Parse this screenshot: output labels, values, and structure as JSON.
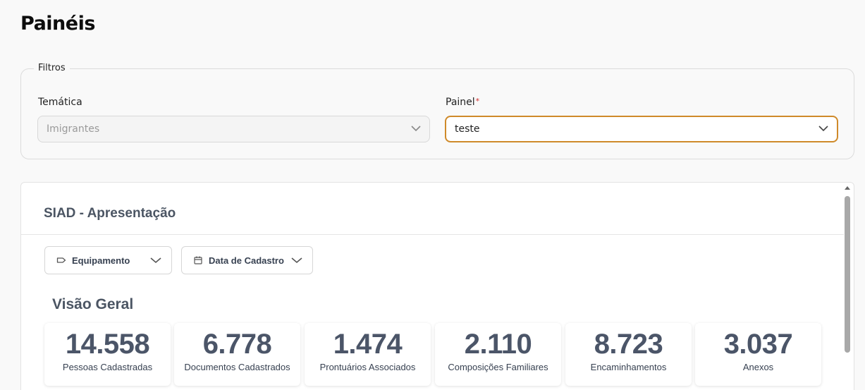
{
  "page": {
    "title": "Painéis"
  },
  "filters": {
    "legend": "Filtros",
    "tematica": {
      "label": "Temática",
      "value": "Imigrantes",
      "disabled": true
    },
    "painel": {
      "label": "Painel",
      "required_mark": "*",
      "value": "teste"
    }
  },
  "dashboard": {
    "title": "SIAD - Apresentação",
    "filters": [
      {
        "label": "Equipamento",
        "icon": "tag-icon"
      },
      {
        "label": "Data de Cadastro",
        "icon": "calendar-icon"
      }
    ],
    "section_title": "Visão Geral",
    "kpis": [
      {
        "value": "14.558",
        "label": "Pessoas Cadastradas"
      },
      {
        "value": "6.778",
        "label": "Documentos Cadastrados"
      },
      {
        "value": "1.474",
        "label": "Prontuários Associados"
      },
      {
        "value": "2.110",
        "label": "Composições Familiares"
      },
      {
        "value": "8.723",
        "label": "Encaminhamentos"
      },
      {
        "value": "3.037",
        "label": "Anexos"
      }
    ]
  },
  "colors": {
    "accent_border": "#cf8a2a",
    "required": "#d32f2f",
    "kpi_text": "#4b5568"
  }
}
